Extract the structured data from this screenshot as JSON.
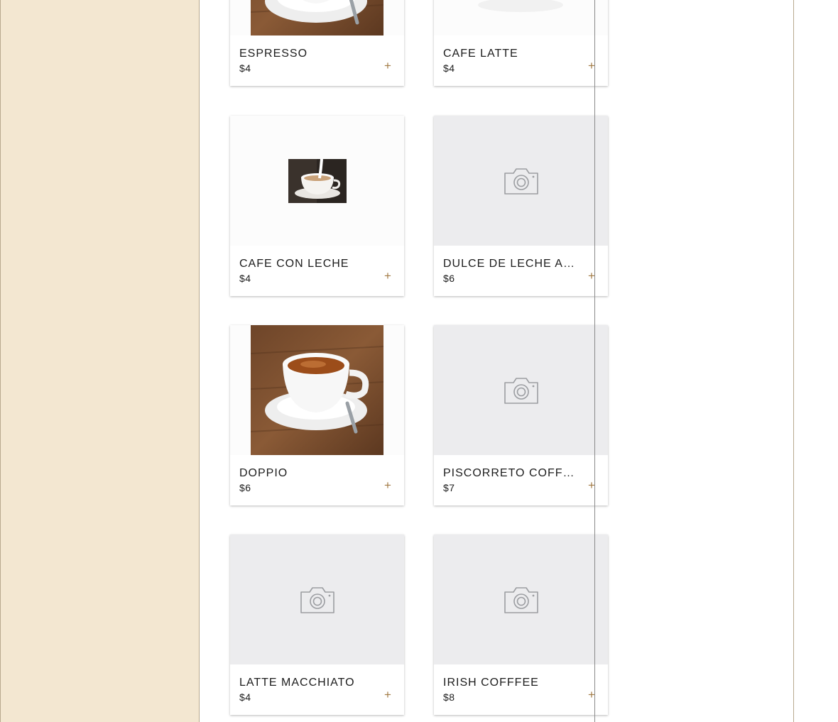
{
  "colors": {
    "sidebar_bg": "#f3e7d1",
    "accent": "#a27a44",
    "placeholder_bg": "#ececee"
  },
  "menu": {
    "items": [
      {
        "name": "ESPRESSO",
        "price": "$4",
        "add_label": "+",
        "image": "espresso-cup-photo"
      },
      {
        "name": "CAFE LATTE",
        "price": "$4",
        "add_label": "+",
        "image": "latte-photo"
      },
      {
        "name": "CAFE CON LECHE",
        "price": "$4",
        "add_label": "+",
        "image": "milk-pour-cup-photo"
      },
      {
        "name": "DULCE DE LECHE AF...",
        "price": "$6",
        "add_label": "+",
        "image": "camera-placeholder-icon"
      },
      {
        "name": "DOPPIO",
        "price": "$6",
        "add_label": "+",
        "image": "espresso-cup-photo"
      },
      {
        "name": "PISCORRETO COFFEE",
        "price": "$7",
        "add_label": "+",
        "image": "camera-placeholder-icon"
      },
      {
        "name": "LATTE MACCHIATO",
        "price": "$4",
        "add_label": "+",
        "image": "camera-placeholder-icon"
      },
      {
        "name": "IRISH COFFFEE",
        "price": "$8",
        "add_label": "+",
        "image": "camera-placeholder-icon"
      }
    ]
  }
}
